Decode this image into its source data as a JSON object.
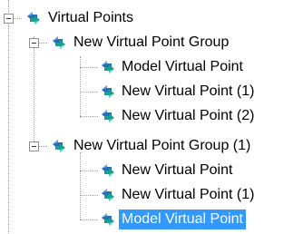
{
  "tree": {
    "root": {
      "label": "Virtual Points",
      "icon": "virtual-point-icon",
      "expanded": true
    },
    "groups": [
      {
        "label": "New Virtual Point Group",
        "icon": "virtual-point-icon",
        "expanded": true,
        "children": [
          {
            "label": "Model Virtual Point",
            "icon": "virtual-point-icon"
          },
          {
            "label": "New Virtual Point (1)",
            "icon": "virtual-point-icon"
          },
          {
            "label": "New Virtual Point (2)",
            "icon": "virtual-point-icon"
          }
        ]
      },
      {
        "label": "New Virtual Point Group (1)",
        "icon": "virtual-point-icon",
        "expanded": true,
        "children": [
          {
            "label": "New Virtual Point",
            "icon": "virtual-point-icon"
          },
          {
            "label": "New Virtual Point (1)",
            "icon": "virtual-point-icon"
          },
          {
            "label": "Model Virtual Point",
            "icon": "virtual-point-icon",
            "selected": true
          }
        ]
      }
    ]
  },
  "colors": {
    "selection": "#3399ff",
    "selection_text": "#ffffff",
    "connector": "#a0a0a0",
    "icon_blue": "#2b6cb8",
    "icon_teal": "#1a9e8f"
  }
}
